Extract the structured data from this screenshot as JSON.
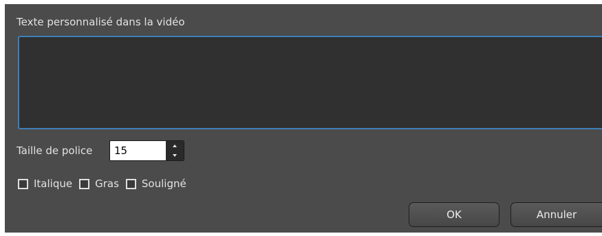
{
  "dialog": {
    "text_label": "Texte personnalisé dans la vidéo",
    "text_value": "",
    "font_size_label": "Taille de police",
    "font_size_value": "15",
    "checkboxes": [
      {
        "label": "Italique",
        "checked": false
      },
      {
        "label": "Gras",
        "checked": false
      },
      {
        "label": "Souligné",
        "checked": false
      }
    ],
    "ok_label": "OK",
    "cancel_label": "Annuler"
  },
  "colors": {
    "dialog_bg": "#4b4b4b",
    "textarea_bg": "#303030",
    "focus_border": "#3d7fb8"
  },
  "icons": {
    "spin_up": "triangle-up-icon",
    "spin_down": "triangle-down-icon"
  }
}
